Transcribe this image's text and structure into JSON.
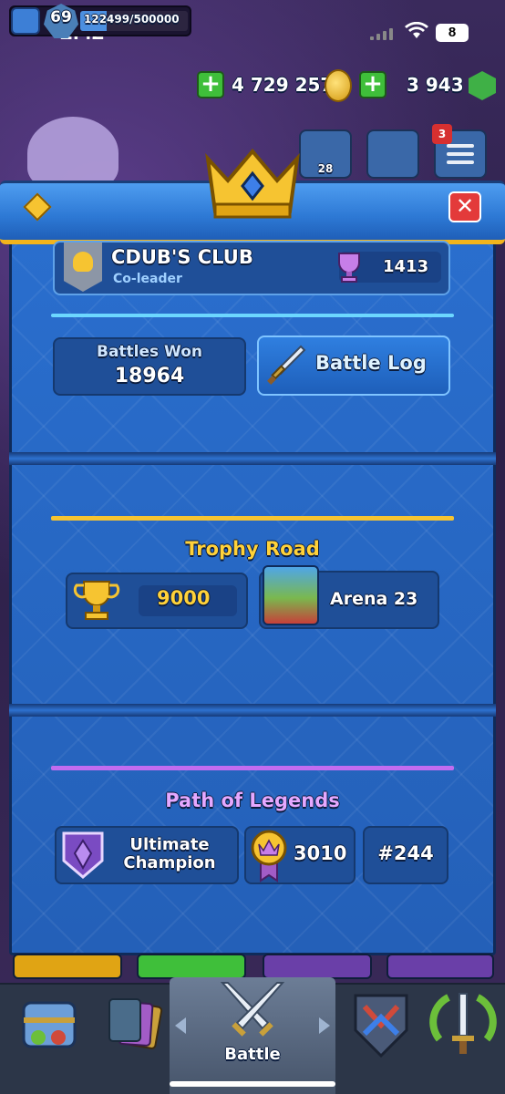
{
  "status_bar": {
    "time": "2:42",
    "battery": "8"
  },
  "resources": {
    "level": "69",
    "xp": "122499/500000",
    "xp_progress": 0.245,
    "gold": "4 729 257",
    "gems": "3 943"
  },
  "top_buttons": {
    "friends_count": "28",
    "menu_badge": "3"
  },
  "clan": {
    "name": "CDUB'S CLUB",
    "role": "Co-leader",
    "trophies": "1413"
  },
  "stats": {
    "battles_won_label": "Battles Won",
    "battles_won_value": "18964",
    "battle_log_label": "Battle Log"
  },
  "trophy_road": {
    "title": "Trophy Road",
    "trophies": "9000",
    "arena": "Arena 23"
  },
  "path_of_legends": {
    "title": "Path of Legends",
    "league_line1": "Ultimate",
    "league_line2": "Champion",
    "rating": "3010",
    "rank": "#244"
  },
  "bottom_nav": {
    "active_label": "Battle"
  },
  "colors": {
    "accent_gold": "#f6c431",
    "trophy_yellow": "#ffd23a",
    "legends_purple": "#c26cf0",
    "divider_cyan": "#6cd7ff",
    "close_red": "#e33a3a"
  }
}
